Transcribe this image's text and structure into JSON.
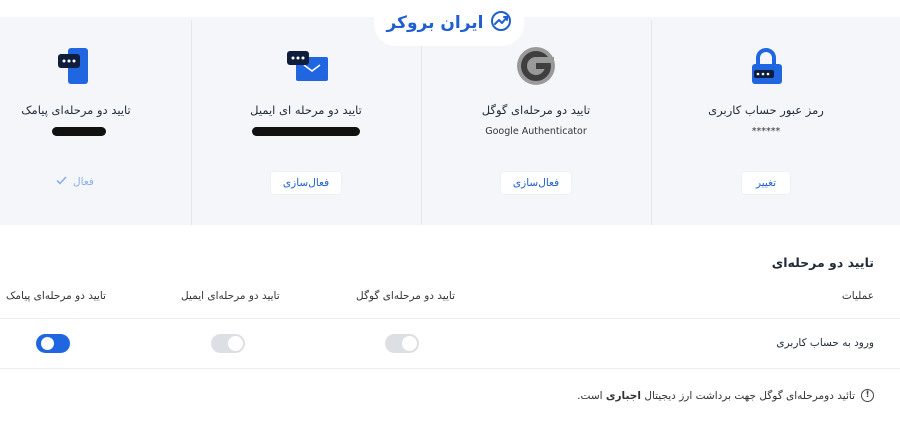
{
  "brand": {
    "name": "ایران بروکر",
    "icon": "trend-chart-icon"
  },
  "cards": [
    {
      "id": "sms",
      "icon": "phone-chat-icon",
      "title": "تایید دو مرحله‌ای پیامک",
      "state_label": "فعال",
      "state_icon": "check-icon",
      "subtitle_redacted": true
    },
    {
      "id": "email",
      "icon": "email-chat-icon",
      "title": "تایید دو مرحله ای ایمیل",
      "button": "فعال‌سازی",
      "subtitle_redacted": true
    },
    {
      "id": "google",
      "icon": "google-authenticator-icon",
      "title": "تایید دو مرحله‌ای گوگل",
      "subtitle": "Google Authenticator",
      "button": "فعال‌سازی"
    },
    {
      "id": "password",
      "icon": "lock-icon",
      "title": "رمز عبور حساب کاربری",
      "subtitle": "******",
      "button": "تغییر"
    }
  ],
  "section": {
    "title": "تایید دو مرحله‌ای",
    "columns": [
      "عملیات",
      "تایید دو مرحله‌ای گوگل",
      "تایید دو مرحله‌ای ایمیل",
      "تایید دو مرحله‌ای پیامک"
    ],
    "rows": [
      {
        "label": "ورود به حساب کاربری",
        "google": false,
        "email": false,
        "sms": true
      }
    ]
  },
  "note": {
    "text_before": "تائید دومرحله‌ای گوگل جهت برداشت ارز دیجیتال",
    "emphasis": "اجباری",
    "text_after": "است.",
    "icon": "info-icon"
  },
  "colors": {
    "accent": "#1f66e0",
    "card_bg": "#f4f6fa",
    "toggle_off": "#dcdfe3",
    "active_text": "#8ab0e8"
  }
}
